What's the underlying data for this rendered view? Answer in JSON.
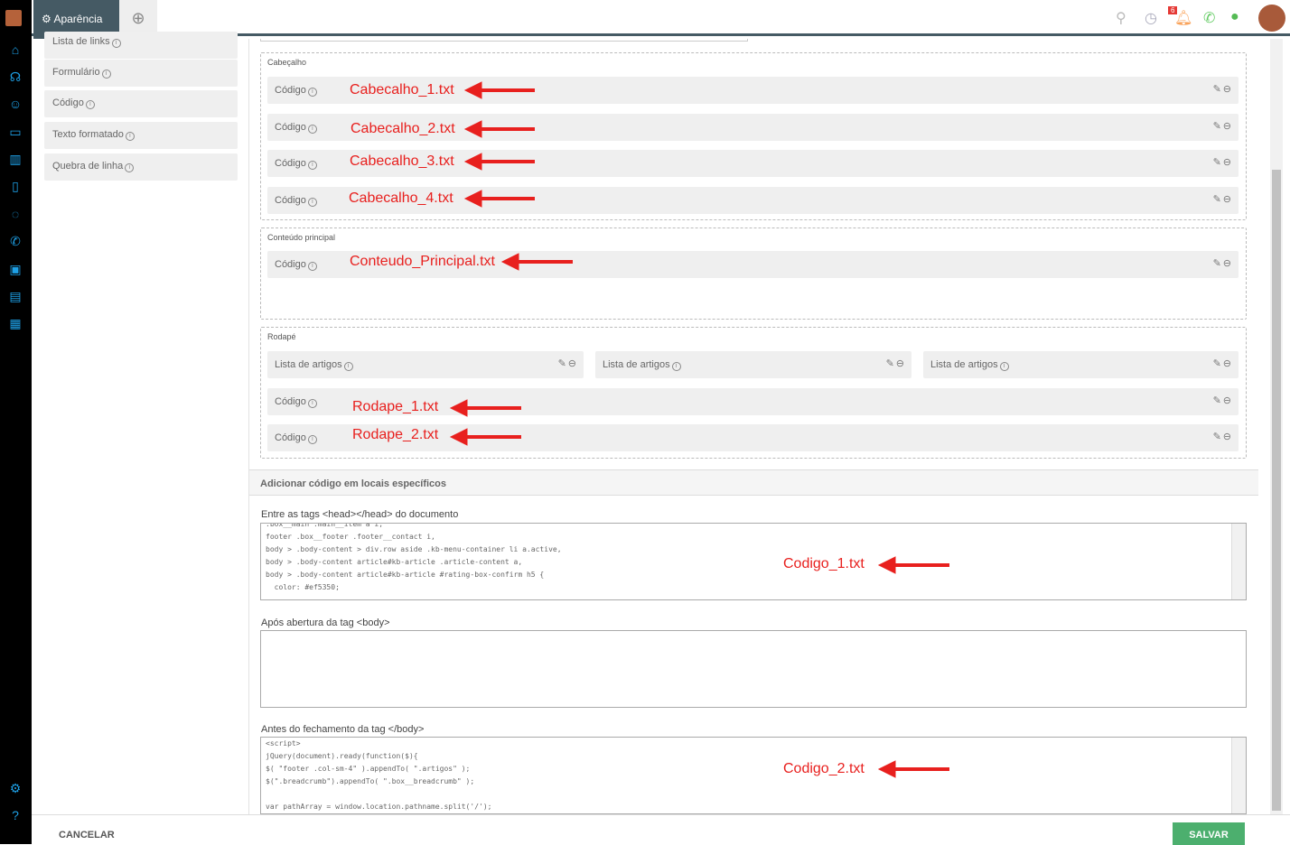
{
  "nav": {
    "icons": [
      "home-icon",
      "headset-icon",
      "contacts-icon",
      "monitor-icon",
      "chart-icon",
      "document-icon",
      "chat-icon",
      "phone-icon",
      "screen-icon",
      "inbox-icon",
      "calendar-icon",
      "settings-icon",
      "help-icon"
    ]
  },
  "tabs": {
    "active": "Aparência",
    "add_icon": "plus-circle-icon"
  },
  "topbar": {
    "notifications_count": "6"
  },
  "left_panel": {
    "items": [
      "Lista de links",
      "Formulário",
      "Código",
      "Texto formatado",
      "Quebra de linha"
    ]
  },
  "sections": {
    "cabecalho": {
      "title": "Cabeçalho",
      "rows": [
        "Código",
        "Código",
        "Código",
        "Código"
      ]
    },
    "conteudo": {
      "title": "Conteúdo principal",
      "rows": [
        "Código"
      ]
    },
    "rodape": {
      "title": "Rodapé",
      "columns": [
        "Lista de artigos",
        "Lista de artigos",
        "Lista de artigos"
      ],
      "rows": [
        "Código",
        "Código"
      ]
    }
  },
  "annotations": {
    "cab": [
      "Cabecalho_1.txt",
      "Cabecalho_2.txt",
      "Cabecalho_3.txt",
      "Cabecalho_4.txt"
    ],
    "conteudo": "Conteudo_Principal.txt",
    "rodape": [
      "Rodape_1.txt",
      "Rodape_2.txt"
    ],
    "codigo1": "Codigo_1.txt",
    "codigo2": "Codigo_2.txt",
    "color": "#e8201e"
  },
  "code_section": {
    "title": "Adicionar código em locais específicos",
    "head_label": "Entre as tags <head></head> do documento",
    "head_code": [
      ".box__main .main__item a i,",
      "footer .box__footer .footer__contact i,",
      "body > .body-content > div.row aside .kb-menu-container li a.active,",
      "body > .body-content article#kb-article .article-content a,",
      "body > .body-content article#kb-article #rating-box-confirm h5 {",
      "  color: #ef5350;"
    ],
    "body_open_label": "Após abertura da tag <body>",
    "body_open_code": "",
    "body_close_label": "Antes do fechamento da tag </body>",
    "body_close_code": [
      "<script>",
      "jQuery(document).ready(function($){",
      "$( \"footer .col-sm-4\" ).appendTo( \".artigos\" );",
      "$(\".breadcrumb\").appendTo( \".box__breadcrumb\" );",
      "",
      "var pathArray = window.location.pathname.split('/');"
    ]
  },
  "footer": {
    "cancel": "CANCELAR",
    "save": "SALVAR",
    "save_color": "#4caf6e"
  }
}
